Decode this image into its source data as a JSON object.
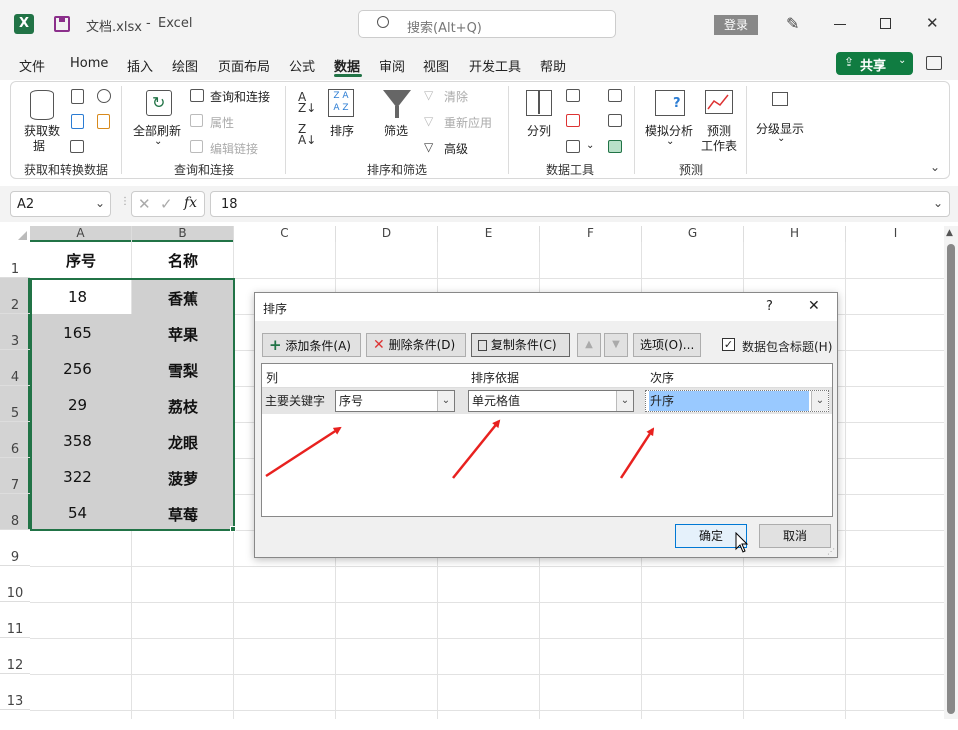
{
  "title_bar": {
    "file_name": "文档.xlsx",
    "separator": "-",
    "app_name": "Excel",
    "search_placeholder": "搜索(Alt+Q)",
    "login": "登录"
  },
  "menu": [
    "文件",
    "Home",
    "插入",
    "绘图",
    "页面布局",
    "公式",
    "数据",
    "审阅",
    "视图",
    "开发工具",
    "帮助"
  ],
  "active_menu": "数据",
  "share_label": "共享",
  "ribbon": {
    "get_data": "获取数",
    "get_data2": "据",
    "group1": "获取和转换数据",
    "refresh_all": "全部刷新",
    "queries": "查询和连接",
    "properties": "属性",
    "edit_links": "编辑链接",
    "group2": "查询和连接",
    "sort": "排序",
    "filter": "筛选",
    "clear": "清除",
    "reapply": "重新应用",
    "advanced": "高级",
    "group3": "排序和筛选",
    "text_to_columns": "分列",
    "group4": "数据工具",
    "what_if": "模拟分析",
    "forecast_sheet": "预测",
    "forecast_sheet2": "工作表",
    "group5": "预测",
    "outline": "分级显示"
  },
  "formula_bar": {
    "name_box": "A2",
    "fx": "fx",
    "value": "18"
  },
  "columns": [
    "A",
    "B",
    "C",
    "D",
    "E",
    "F",
    "G",
    "H",
    "I"
  ],
  "rows": [
    "1",
    "2",
    "3",
    "4",
    "5",
    "6",
    "7",
    "8",
    "9",
    "10",
    "11",
    "12",
    "13"
  ],
  "cells": {
    "a1": "序号",
    "b1": "名称",
    "data": [
      [
        "18",
        "香蕉"
      ],
      [
        "165",
        "苹果"
      ],
      [
        "256",
        "雪梨"
      ],
      [
        "29",
        "荔枝"
      ],
      [
        "358",
        "龙眼"
      ],
      [
        "322",
        "菠萝"
      ],
      [
        "54",
        "草莓"
      ]
    ]
  },
  "dialog": {
    "title": "排序",
    "help": "?",
    "close": "✕",
    "add_level": "添加条件(A)",
    "delete_level": "删除条件(D)",
    "copy_level": "复制条件(C)",
    "options": "选项(O)...",
    "has_headers": "数据包含标题(H)",
    "has_headers_checked": true,
    "col_header": "列",
    "sort_on_header": "排序依据",
    "order_header": "次序",
    "sort_by_label": "主要关键字",
    "sort_by_value": "序号",
    "sort_on_value": "单元格值",
    "order_value": "升序",
    "ok": "确定",
    "cancel": "取消"
  },
  "colors": {
    "excel_green": "#217346",
    "share_green": "#107c41",
    "arrow_red": "#e8211f",
    "selection_fill": "#d0d0d0",
    "highlight_blue": "#99c9ff"
  }
}
